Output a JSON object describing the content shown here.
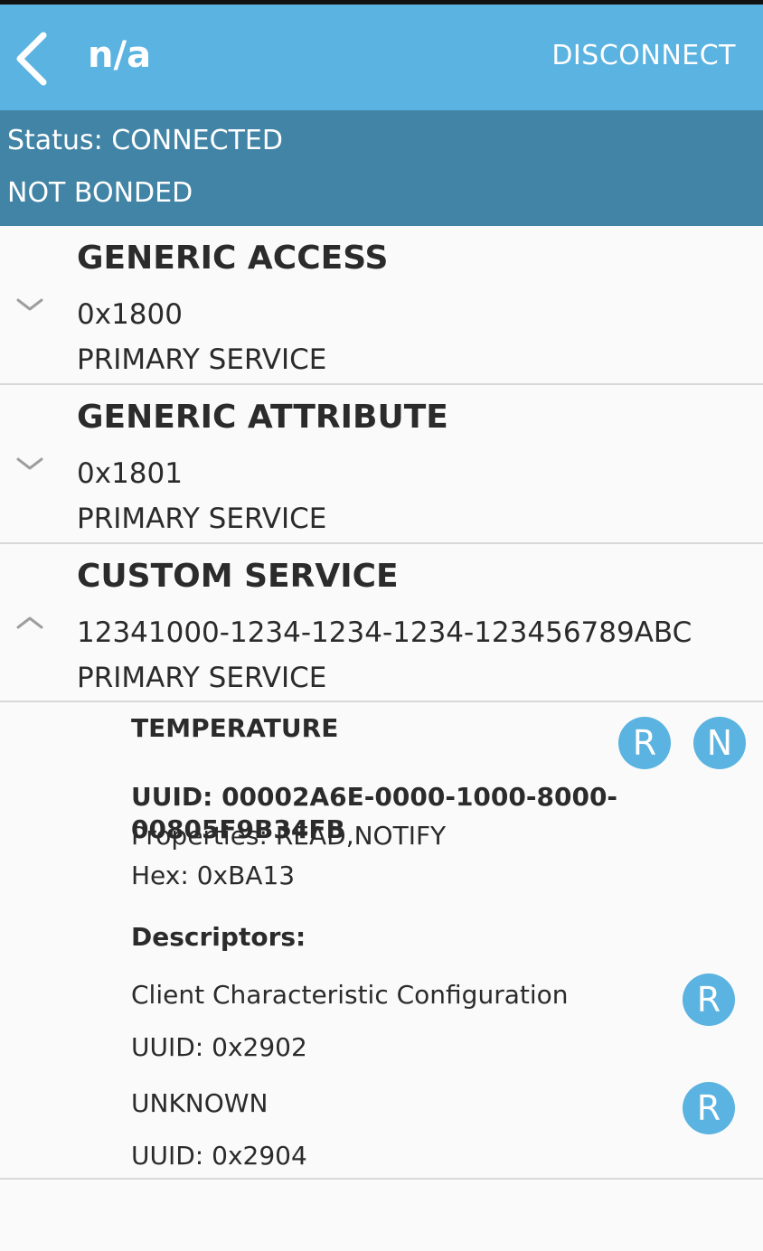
{
  "header": {
    "title": "n/a",
    "disconnect_label": "DISCONNECT"
  },
  "status": {
    "connection": "Status: CONNECTED",
    "bond": "NOT BONDED"
  },
  "services": [
    {
      "name": "GENERIC ACCESS",
      "uuid": "0x1800",
      "type": "PRIMARY SERVICE",
      "expanded": false
    },
    {
      "name": "GENERIC ATTRIBUTE",
      "uuid": "0x1801",
      "type": "PRIMARY SERVICE",
      "expanded": false
    },
    {
      "name": "CUSTOM SERVICE",
      "uuid": "12341000-1234-1234-1234-123456789ABC",
      "type": "PRIMARY SERVICE",
      "expanded": true
    }
  ],
  "characteristic": {
    "name": "TEMPERATURE",
    "badges": [
      "R",
      "N"
    ],
    "uuid": "UUID: 00002A6E-0000-1000-8000-00805F9B34FB",
    "properties": "Properties: READ,NOTIFY",
    "hex": "Hex: 0xBA13",
    "descriptors_label": "Descriptors:",
    "descriptors": [
      {
        "name": "Client Characteristic Configuration",
        "uuid": "UUID: 0x2902",
        "badge": "R"
      },
      {
        "name": "UNKNOWN",
        "uuid": "UUID: 0x2904",
        "badge": "R"
      }
    ]
  },
  "colors": {
    "appbar": "#5ab3e0",
    "statusbar": "#4284a6",
    "badge": "#5ab3e0"
  },
  "icons": {
    "back": "back-arrow-icon",
    "collapsed": "chevron-down-icon",
    "expanded": "chevron-up-icon"
  }
}
